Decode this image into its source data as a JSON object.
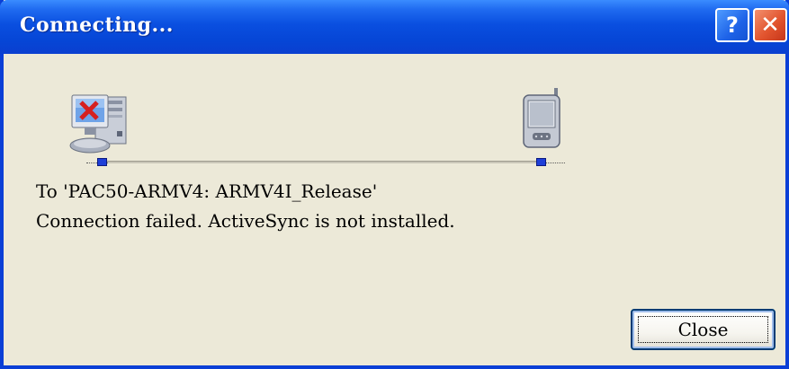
{
  "window": {
    "title": "Connecting...",
    "help_button": "?",
    "close_glyph": "✕"
  },
  "status": {
    "target_line": "To 'PAC50-ARMV4: ARMV4I_Release'",
    "message_line": "Connection failed. ActiveSync is not installed."
  },
  "icons": {
    "source": "computer-error-icon",
    "destination": "pda-device-icon"
  },
  "buttons": {
    "close_label": "Close"
  },
  "colors": {
    "titlebar": "#0A4FE0",
    "window_bg": "#ECE9D8",
    "close_red": "#E2552F"
  }
}
